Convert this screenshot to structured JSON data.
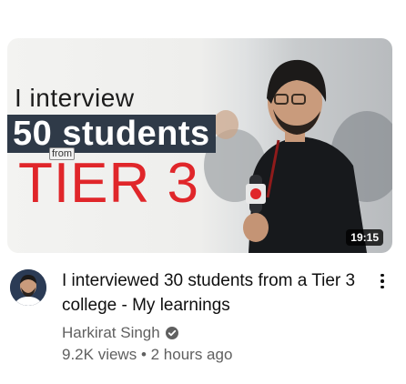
{
  "thumbnail": {
    "line1": "I interview",
    "line2": "50 students",
    "from_tag": "from",
    "line3": "TIER 3",
    "duration": "19:15"
  },
  "video": {
    "title": "I interviewed 30 students from a Tier 3 college - My learnings",
    "channel": "Harkirat Singh",
    "verified_icon": "verified-check-icon",
    "views": "9.2K views",
    "separator": "•",
    "age": "2 hours ago"
  },
  "icons": {
    "menu": "more-vert-icon",
    "avatar": "channel-avatar"
  },
  "colors": {
    "title_red": "#e0262a",
    "banner_navy": "#2f3a48",
    "meta_gray": "#606060"
  }
}
